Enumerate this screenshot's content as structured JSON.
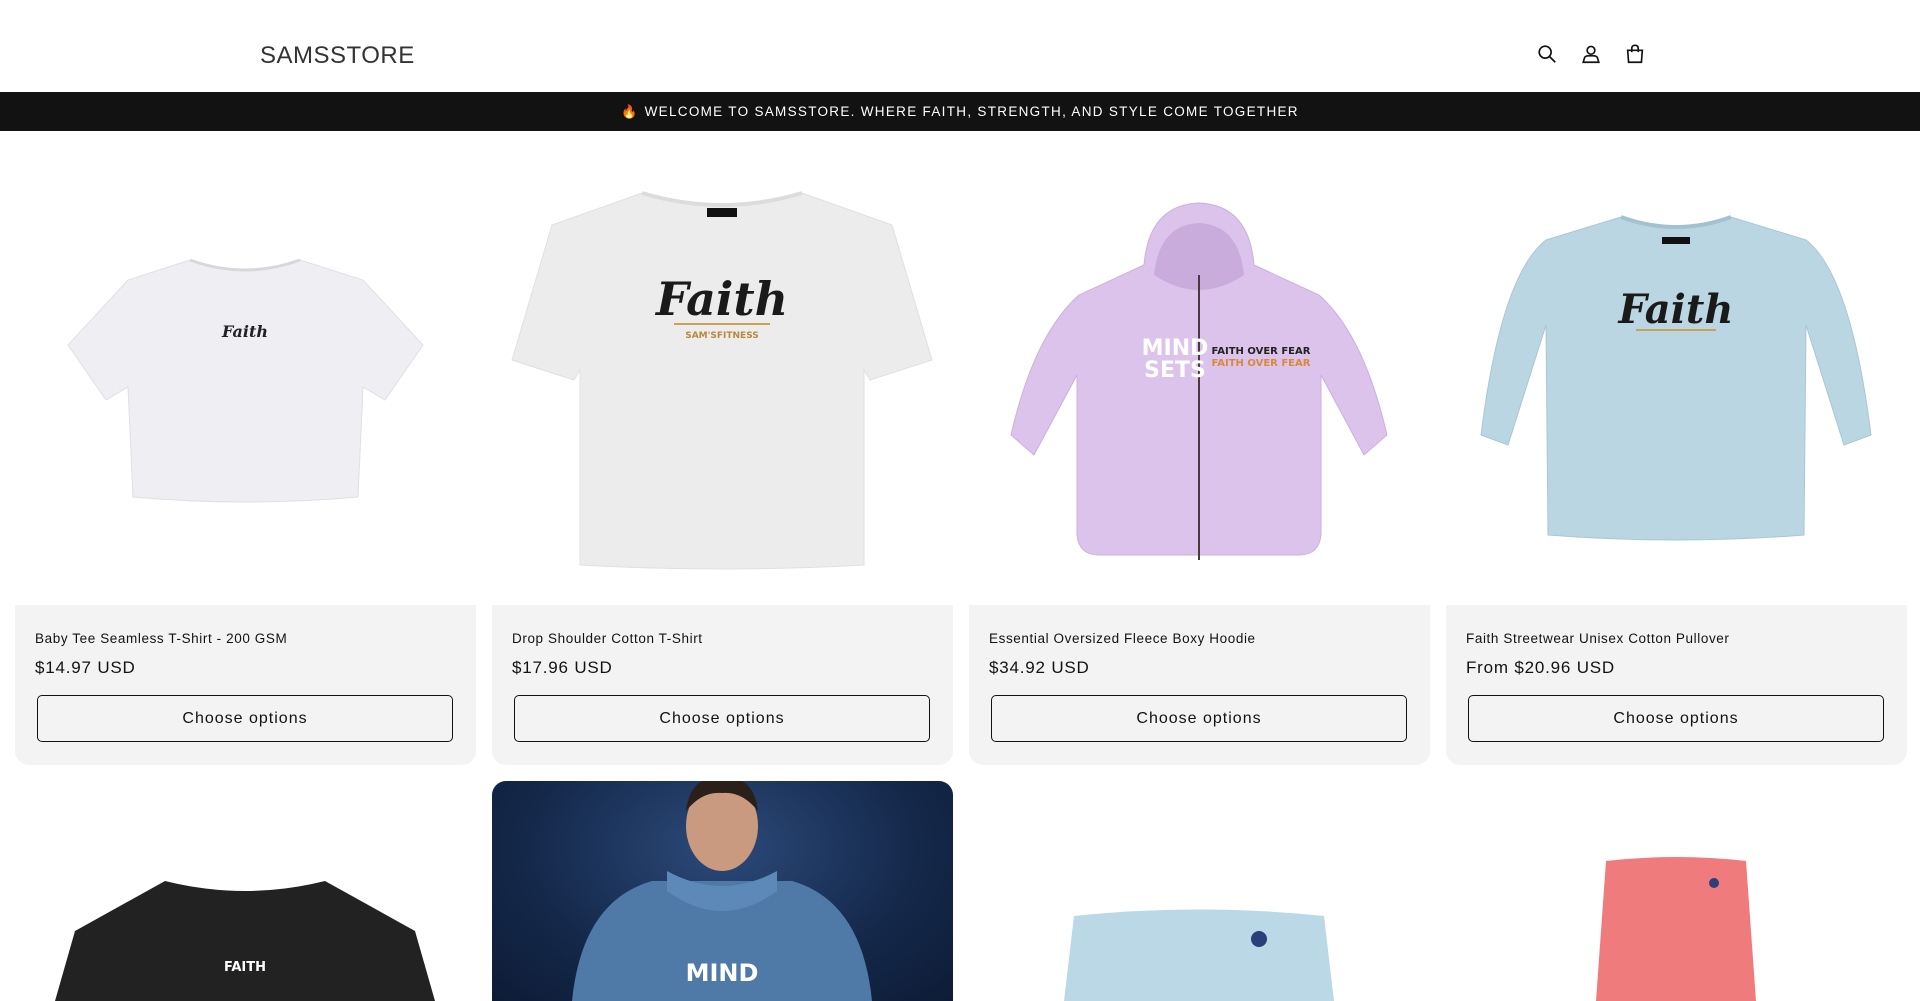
{
  "header": {
    "logo": "SAMSSTORE",
    "icons": [
      "search-icon",
      "account-icon",
      "cart-icon"
    ]
  },
  "announcement": {
    "icon": "flame-icon",
    "text": "WELCOME TO SAMSSTORE. WHERE FAITH, STRENGTH, AND STYLE COME TOGETHER"
  },
  "products": [
    {
      "title": "Baby Tee Seamless T-Shirt - 200 GSM",
      "price": "$14.97 USD",
      "button": "Choose options",
      "image": "white-baby-tee"
    },
    {
      "title": "Drop Shoulder Cotton T-Shirt",
      "price": "$17.96 USD",
      "button": "Choose options",
      "image": "white-drop-shoulder-tee"
    },
    {
      "title": "Essential Oversized Fleece Boxy Hoodie",
      "price": "$34.92 USD",
      "button": "Choose options",
      "image": "lavender-zip-hoodie"
    },
    {
      "title": "Faith Streetwear Unisex Cotton Pullover",
      "price": "From $20.96 USD",
      "button": "Choose options",
      "image": "light-blue-pullover"
    }
  ],
  "row2": [
    {
      "image": "black-crop-tee"
    },
    {
      "image": "model-blue-hoodie"
    },
    {
      "image": "light-blue-shorts"
    },
    {
      "image": "coral-leggings"
    }
  ],
  "print_text": {
    "faith": "Faith",
    "samsfitness": "SAM'SFITNESS",
    "faith_over_fear": "FAITH OVER FEAR",
    "mind": "MIND",
    "sets": "SETS",
    "faith_caps": "FAITH"
  },
  "colors": {
    "announcement_bg": "#121212",
    "card_bg": "#f3f3f3",
    "text": "#121212"
  }
}
